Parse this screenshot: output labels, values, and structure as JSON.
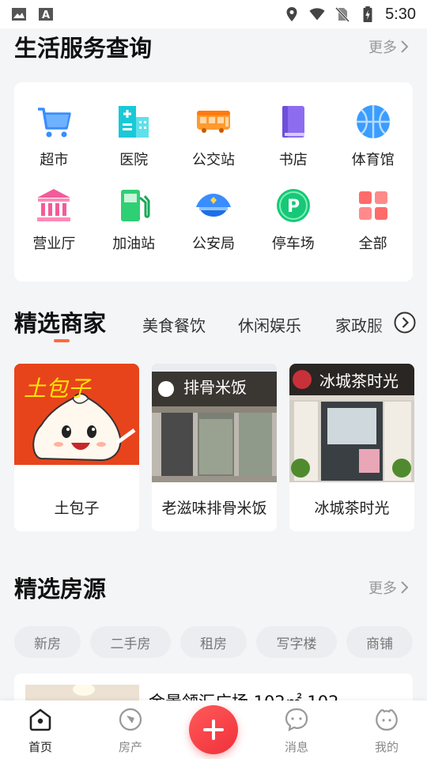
{
  "status_bar": {
    "time": "5:30",
    "left_icons": [
      "image-icon",
      "text-a-icon"
    ],
    "right_icons": [
      "location-icon",
      "wifi-icon",
      "no-sim-icon",
      "battery-charging-icon"
    ]
  },
  "life_services": {
    "title": "生活服务查询",
    "more_label": "更多",
    "items": [
      {
        "label": "超市",
        "icon": "shopping-cart-icon",
        "color": "#3a8dff"
      },
      {
        "label": "医院",
        "icon": "hospital-icon",
        "color": "#19c9d8"
      },
      {
        "label": "公交站",
        "icon": "bus-icon",
        "color": "#ff8a1e"
      },
      {
        "label": "书店",
        "icon": "book-icon",
        "color": "#8d6cf0"
      },
      {
        "label": "体育馆",
        "icon": "basketball-icon",
        "color": "#3a9dff"
      },
      {
        "label": "营业厅",
        "icon": "bank-icon",
        "color": "#f35b9a"
      },
      {
        "label": "加油站",
        "icon": "gas-station-icon",
        "color": "#2fcf73"
      },
      {
        "label": "公安局",
        "icon": "police-cap-icon",
        "color": "#3a8dff"
      },
      {
        "label": "停车场",
        "icon": "parking-icon",
        "color": "#17c878"
      },
      {
        "label": "全部",
        "icon": "grid-icon",
        "color": "#ff6b6b"
      }
    ]
  },
  "merchants": {
    "title": "精选商家",
    "tabs": [
      "美食餐饮",
      "休闲娱乐",
      "家政服"
    ],
    "accent": "#ff6a3d",
    "cards": [
      {
        "name": "土包子",
        "image": "cartoon-bun-logo",
        "logo_text": "土包子"
      },
      {
        "name": "老滋味排骨米饭",
        "image": "restaurant-storefront",
        "sign_text": "排骨米饭"
      },
      {
        "name": "冰城茶时光",
        "image": "tea-shop-storefront",
        "sign_text": "冰城茶时光"
      }
    ]
  },
  "housing": {
    "title": "精选房源",
    "more_label": "更多",
    "chips": [
      "新房",
      "二手房",
      "租房",
      "写字楼",
      "商铺"
    ],
    "listing_title": "金景领汇广场 102㎡ 102"
  },
  "bottom_nav": {
    "items": [
      {
        "label": "首页",
        "icon": "home-icon",
        "active": true
      },
      {
        "label": "房产",
        "icon": "compass-icon",
        "active": false
      },
      {
        "label": "消息",
        "icon": "chat-icon",
        "active": false
      },
      {
        "label": "我的",
        "icon": "profile-icon",
        "active": false
      }
    ],
    "fab_icon": "plus-icon",
    "fab_color": "#f0303a"
  }
}
